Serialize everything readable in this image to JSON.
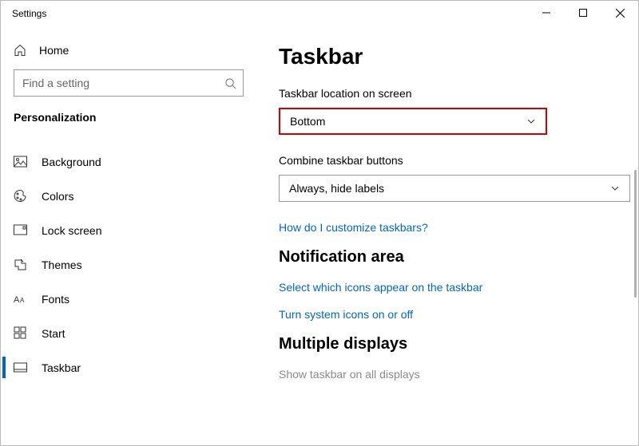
{
  "window": {
    "title": "Settings"
  },
  "sidebar": {
    "home": "Home",
    "search_placeholder": "Find a setting",
    "section": "Personalization",
    "items": [
      {
        "label": "Background"
      },
      {
        "label": "Colors"
      },
      {
        "label": "Lock screen"
      },
      {
        "label": "Themes"
      },
      {
        "label": "Fonts"
      },
      {
        "label": "Start"
      },
      {
        "label": "Taskbar"
      }
    ]
  },
  "main": {
    "heading": "Taskbar",
    "location_label": "Taskbar location on screen",
    "location_value": "Bottom",
    "combine_label": "Combine taskbar buttons",
    "combine_value": "Always, hide labels",
    "link_customize": "How do I customize taskbars?",
    "notification_heading": "Notification area",
    "link_icons": "Select which icons appear on the taskbar",
    "link_system_icons": "Turn system icons on or off",
    "multi_heading": "Multiple displays",
    "multi_sub": "Show taskbar on all displays"
  }
}
